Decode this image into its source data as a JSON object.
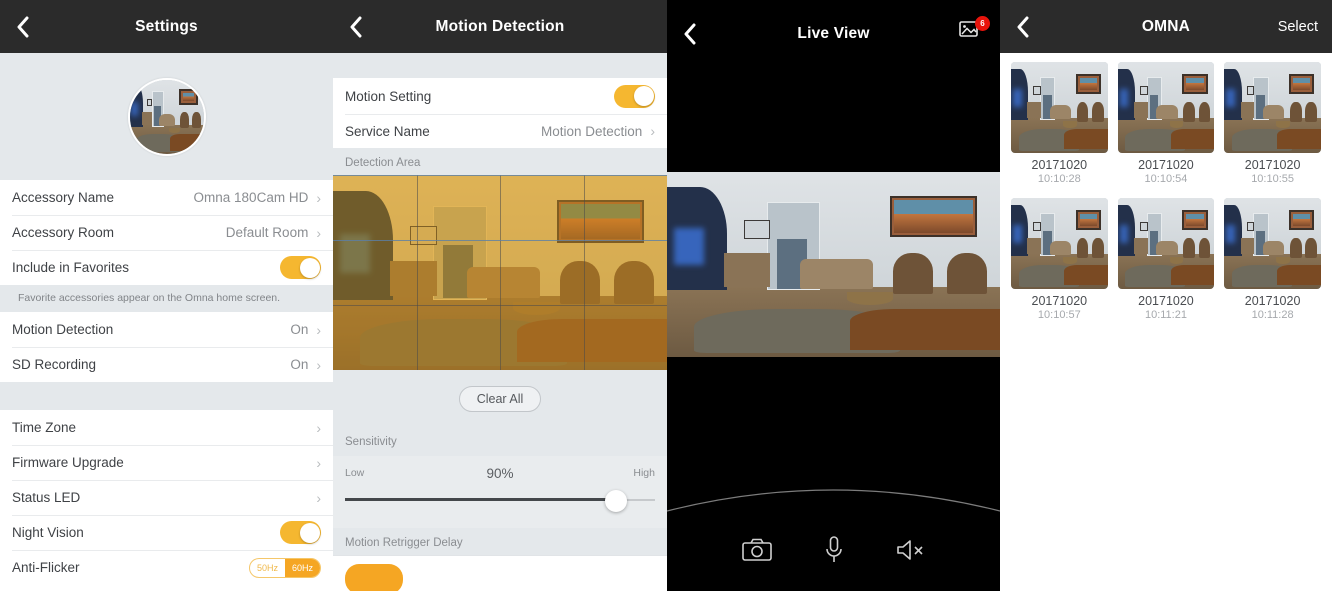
{
  "panel_settings": {
    "nav": {
      "title": "Settings",
      "back_icon": "chevron-left-icon"
    },
    "accessory_name": {
      "label": "Accessory Name",
      "value": "Omna 180Cam HD"
    },
    "accessory_room": {
      "label": "Accessory Room",
      "value": "Default Room"
    },
    "include_favorites": {
      "label": "Include in Favorites",
      "state": "on"
    },
    "favorites_note": "Favorite accessories appear on the Omna home screen.",
    "motion_detection": {
      "label": "Motion Detection",
      "value": "On"
    },
    "sd_recording": {
      "label": "SD Recording",
      "value": "On"
    },
    "time_zone": {
      "label": "Time Zone"
    },
    "firmware_upgrade": {
      "label": "Firmware Upgrade"
    },
    "status_led": {
      "label": "Status LED"
    },
    "night_vision": {
      "label": "Night Vision",
      "state": "on"
    },
    "anti_flicker": {
      "label": "Anti-Flicker",
      "options": [
        "50Hz",
        "60Hz"
      ],
      "selected": "60Hz"
    }
  },
  "panel_motion": {
    "nav": {
      "title": "Motion Detection",
      "back_icon": "chevron-left-icon"
    },
    "motion_setting": {
      "label": "Motion Setting",
      "state": "on"
    },
    "service_name": {
      "label": "Service Name",
      "value": "Motion Detection"
    },
    "detection_area": {
      "header": "Detection Area",
      "clear_all": "Clear All",
      "grid_cols": 4,
      "grid_rows": 3
    },
    "sensitivity": {
      "header": "Sensitivity",
      "low_label": "Low",
      "high_label": "High",
      "percent_label": "90%",
      "value": 90
    },
    "retrigger": {
      "header": "Motion Retrigger Delay"
    }
  },
  "panel_live": {
    "nav": {
      "title": "Live View",
      "back_icon": "chevron-left-icon",
      "gallery_icon": "photo-gallery-icon",
      "badge": "6"
    },
    "controls": [
      {
        "name": "snapshot-button",
        "icon": "camera-icon"
      },
      {
        "name": "talk-button",
        "icon": "microphone-icon"
      },
      {
        "name": "mute-button",
        "icon": "speaker-muted-icon"
      }
    ]
  },
  "panel_gallery": {
    "nav": {
      "title": "OMNA",
      "back_icon": "chevron-left-icon",
      "select_label": "Select"
    },
    "items": [
      {
        "date": "20171020",
        "time": "10:10:28"
      },
      {
        "date": "20171020",
        "time": "10:10:54"
      },
      {
        "date": "20171020",
        "time": "10:10:55"
      },
      {
        "date": "20171020",
        "time": "10:10:57"
      },
      {
        "date": "20171020",
        "time": "10:11:21"
      },
      {
        "date": "20171020",
        "time": "10:11:28"
      }
    ]
  },
  "colors": {
    "accent": "#f5b730",
    "accent_strong": "#f5a623",
    "navbar": "#2b2b2b",
    "group_bg": "#e4e8eb",
    "badge_red": "#e8140c"
  }
}
